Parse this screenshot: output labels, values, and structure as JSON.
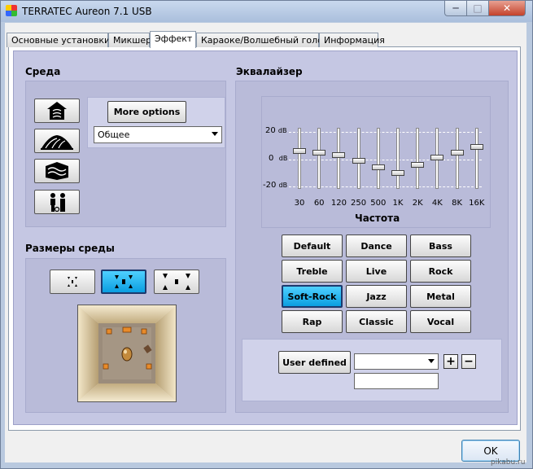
{
  "window": {
    "title": "TERRATEC Aureon 7.1 USB",
    "min_glyph": "─",
    "max_glyph": "□",
    "close_glyph": "✕"
  },
  "tabs": [
    {
      "label": "Основные установки"
    },
    {
      "label": "Микшер"
    },
    {
      "label": "Эффект",
      "active": true
    },
    {
      "label": "Караоке/Волшебный голос"
    },
    {
      "label": "Информация"
    }
  ],
  "environment": {
    "title": "Среда",
    "more_options": "More options",
    "preset_value": "Общее",
    "icons": [
      "stone-room-icon",
      "concert-hall-icon",
      "underwater-icon",
      "bathroom-icon"
    ]
  },
  "room_size": {
    "title": "Размеры среды",
    "icons": [
      "small-room-icon",
      "medium-room-icon",
      "large-room-icon"
    ],
    "selected_index": 1
  },
  "equalizer": {
    "title": "Эквалайзер",
    "db_labels": [
      {
        "value": "20",
        "unit": "dB"
      },
      {
        "value": "0",
        "unit": "dB"
      },
      {
        "value": "-20",
        "unit": "dB"
      }
    ],
    "range_db": [
      -20,
      20
    ],
    "bands": [
      {
        "freq": "30",
        "gain_db": 6
      },
      {
        "freq": "60",
        "gain_db": 5
      },
      {
        "freq": "120",
        "gain_db": 3
      },
      {
        "freq": "250",
        "gain_db": -1
      },
      {
        "freq": "500",
        "gain_db": -6
      },
      {
        "freq": "1K",
        "gain_db": -10
      },
      {
        "freq": "2K",
        "gain_db": -4
      },
      {
        "freq": "4K",
        "gain_db": 1
      },
      {
        "freq": "8K",
        "gain_db": 5
      },
      {
        "freq": "16K",
        "gain_db": 9
      }
    ],
    "freq_title": "Частота",
    "presets": [
      "Default",
      "Dance",
      "Bass",
      "Treble",
      "Live",
      "Rock",
      "Soft-Rock",
      "Jazz",
      "Metal",
      "Rap",
      "Classic",
      "Vocal"
    ],
    "selected_preset": "Soft-Rock",
    "user_defined": "User defined",
    "user_select_value": "",
    "user_name_value": "",
    "plus": "+",
    "minus": "−"
  },
  "footer": {
    "ok": "OK",
    "watermark": "pikabu.ru"
  },
  "colors": {
    "board": "#c5c7e3",
    "panel": "#b9bbd9",
    "selected": "#0a9ee0"
  }
}
